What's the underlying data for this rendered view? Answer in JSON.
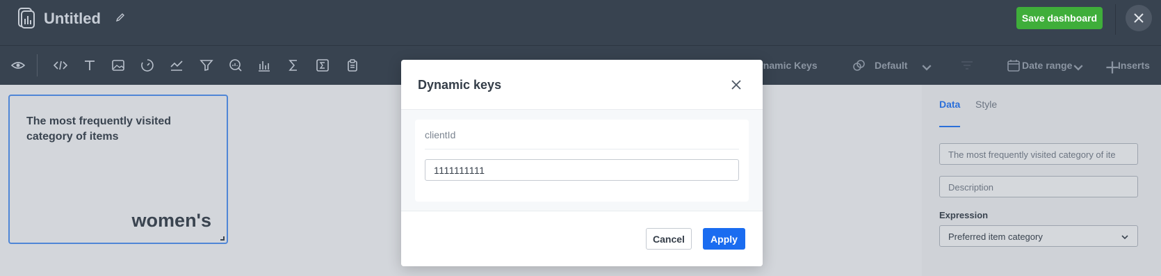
{
  "header": {
    "title": "Untitled",
    "save_label": "Save dashboard",
    "accent_color": "#3fae3a"
  },
  "toolbar": {
    "icons": [
      "eye-icon",
      "code-icon",
      "text-icon",
      "image-icon",
      "gauge-icon",
      "line-chart-icon",
      "filter-icon",
      "search-chart-icon",
      "bar-chart-icon",
      "sigma-icon",
      "sum-box-icon",
      "clipboard-icon"
    ],
    "dynamic_keys_label": "ynamic Keys",
    "theme_label": "Default",
    "date_range_label": "Date range",
    "inserts_label": "Inserts"
  },
  "widget": {
    "title": "The most frequently visited category of items",
    "value": "women's"
  },
  "panel": {
    "tabs": [
      {
        "label": "Data",
        "active": true
      },
      {
        "label": "Style",
        "active": false
      }
    ],
    "name_value": "The most frequently visited category of ite",
    "description_placeholder": "Description",
    "expression_label": "Expression",
    "expression_value": "Preferred item category"
  },
  "modal": {
    "title": "Dynamic keys",
    "key_label": "clientId",
    "key_value": "1111111111",
    "cancel_label": "Cancel",
    "apply_label": "Apply",
    "primary_color": "#1a6cf0"
  }
}
